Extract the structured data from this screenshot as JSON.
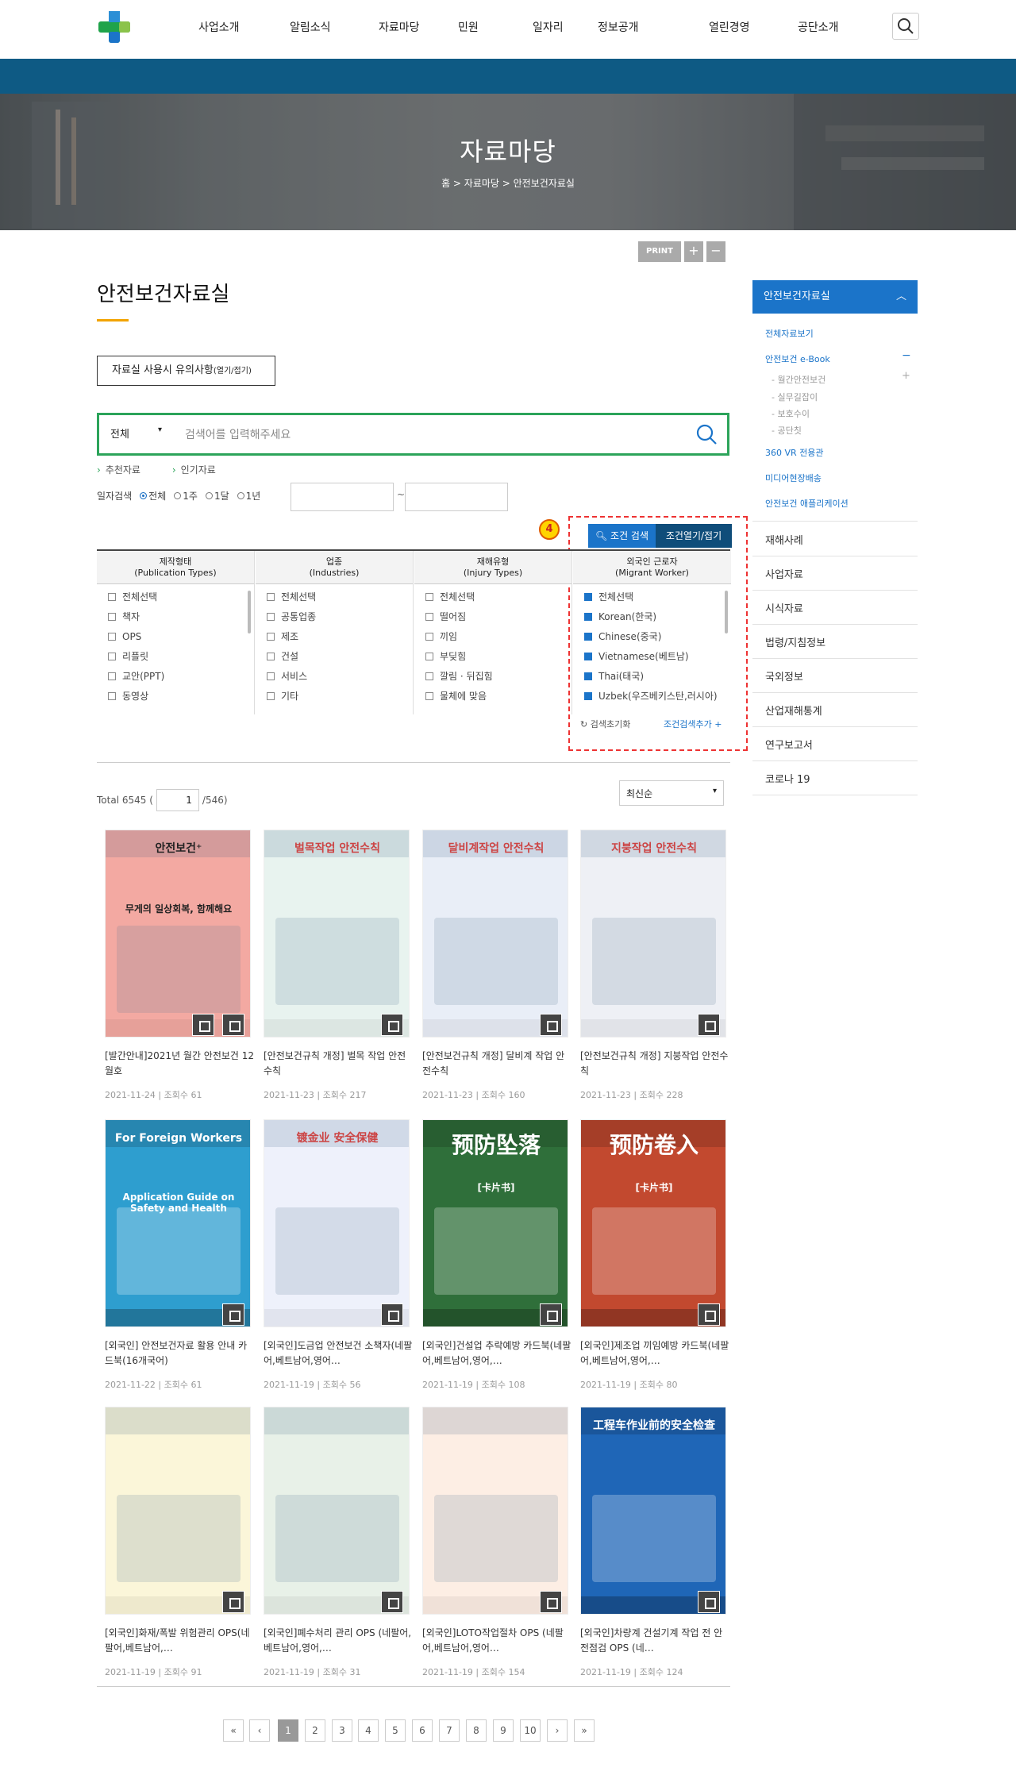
{
  "header": {
    "nav": [
      "사업소개",
      "알림소식",
      "자료마당",
      "민원",
      "일자리",
      "정보공개",
      "열린경영",
      "공단소개"
    ]
  },
  "hero": {
    "title": "자료마당",
    "breadcrumb": "홈  >  자료마당  >  안전보건자료실"
  },
  "tools": {
    "print": "PRINT",
    "zoom_in": "+",
    "zoom_out": "−"
  },
  "page": {
    "title": "안전보건자료실",
    "notice_button": "자료실 사용시 유의사항",
    "notice_toggle": "(열기/접기)"
  },
  "search": {
    "category": "전체",
    "placeholder": "검색어를 입력해주세요",
    "tags": [
      "추천자료",
      "인기자료"
    ],
    "date_label": "일자검색",
    "date_options": [
      "전체",
      "1주",
      "1달",
      "1년"
    ],
    "date_selected": "전체",
    "date_sep": "~"
  },
  "annotation": {
    "number": "4"
  },
  "filter": {
    "tab_search": "조건 검색",
    "tab_toggle": "조건열기/접기",
    "columns": [
      {
        "title": "제작형태",
        "subtitle": "(Publication Types)",
        "items": [
          "전체선택",
          "책자",
          "OPS",
          "리플릿",
          "교안(PPT)",
          "동영상"
        ],
        "checked": []
      },
      {
        "title": "업종",
        "subtitle": "(Industries)",
        "items": [
          "전체선택",
          "공통업종",
          "제조",
          "건설",
          "서비스",
          "기타"
        ],
        "checked": []
      },
      {
        "title": "재해유형",
        "subtitle": "(Injury Types)",
        "items": [
          "전체선택",
          "떨어짐",
          "끼임",
          "부딪힘",
          "깔림 · 뒤집힘",
          "물체에 맞음"
        ],
        "checked": []
      },
      {
        "title": "외국인 근로자",
        "subtitle": "(Migrant Worker)",
        "items": [
          "전체선택",
          "Korean(한국)",
          "Chinese(중국)",
          "Vietnamese(베트남)",
          "Thai(태국)",
          "Uzbek(우즈베키스탄,러시아)"
        ],
        "checked": [
          0,
          1,
          2,
          3,
          4,
          5
        ]
      }
    ],
    "reset": "검색초기화",
    "add": "조건검색추가 +"
  },
  "listing": {
    "total_label": "Total",
    "total": "6545",
    "current_page": "1",
    "total_pages": "/546)",
    "sort": "최신순"
  },
  "cards": [
    {
      "title": "[발간안내]2021년 월간 안전보건 12월호",
      "date": "2021-11-24",
      "views": "조회수 61",
      "cover_title": "안전보건⁺",
      "cover_text": "무게의 일상회복, 함께해요",
      "bg": "#f3a9a2"
    },
    {
      "title": "[안전보건규칙 개정] 벌목 작업 안전수칙",
      "date": "2021-11-23",
      "views": "조회수 217",
      "cover_title": "벌목작업 안전수칙",
      "bg": "#e8f3ef"
    },
    {
      "title": "[안전보건규칙 개정] 달비계 작업 안전수칙",
      "date": "2021-11-23",
      "views": "조회수 160",
      "cover_title": "달비계작업 안전수칙",
      "bg": "#e9eef7"
    },
    {
      "title": "[안전보건규칙 개정] 지붕작업 안전수칙",
      "date": "2021-11-23",
      "views": "조회수 228",
      "cover_title": "지붕작업 안전수칙",
      "bg": "#eef0f5"
    },
    {
      "title": "[외국인] 안전보건자료 활용 안내 카드북(16개국어)",
      "date": "2021-11-22",
      "views": "조회수 61",
      "cover_title": "For Foreign Workers",
      "cover_text": "Application Guide on Safety and Health",
      "bg": "#2e9ecf"
    },
    {
      "title": "[외국인]도금업 안전보건 소책자(네팔어,베트남어,영어…",
      "date": "2021-11-19",
      "views": "조회수 56",
      "cover_title": "镀金业 安全保健",
      "bg": "#eef1fb"
    },
    {
      "title": "[외국인]건설업 추락예방 카드북(네팔어,베트남어,영어,…",
      "date": "2021-11-19",
      "views": "조회수 108",
      "cover_title": "预防坠落",
      "cover_text": "[卡片书]",
      "bg": "#2f6f3a"
    },
    {
      "title": "[외국인]제조업 끼임예방 카드북(네팔어,베트남어,영어,…",
      "date": "2021-11-19",
      "views": "조회수 80",
      "cover_title": "预防卷入",
      "cover_text": "[卡片书]",
      "bg": "#c2492f"
    },
    {
      "title": "[외국인]화재/폭발 위험관리 OPS(네팔어,베트남어,…",
      "date": "2021-11-19",
      "views": "조회수 91",
      "cover_title": "",
      "bg": "#fbf6d9"
    },
    {
      "title": "[외국인]폐수처리 관리 OPS (네팔어,베트남어,영어,…",
      "date": "2021-11-19",
      "views": "조회수 31",
      "cover_title": "",
      "bg": "#e8f1e8"
    },
    {
      "title": "[외국인]LOTO작업절차 OPS (네팔어,베트남어,영어…",
      "date": "2021-11-19",
      "views": "조회수 154",
      "cover_title": "",
      "bg": "#fdeee4"
    },
    {
      "title": "[외국인]차량계 건설기계 작업 전 안전점검 OPS (네…",
      "date": "2021-11-19",
      "views": "조회수 124",
      "cover_title": "工程车作业前的安全检查",
      "bg": "#1f66b7"
    }
  ],
  "sidebar": {
    "header": "안전보건자료실",
    "links": [
      "전체자료보기",
      "안전보건 e-Book"
    ],
    "sub": [
      "월간안전보건",
      "실무길잡이",
      "보호수이",
      "공단칫"
    ],
    "links2": [
      "360 VR 전용관",
      "미디어현장배송",
      "안전보건 애플리케이션"
    ],
    "items": [
      "재해사례",
      "사업자료",
      "시식자료",
      "법령/지침정보",
      "국외정보",
      "산업재해통계",
      "연구보고서",
      "코로나 19"
    ]
  },
  "pagination": [
    "«",
    "‹",
    "1",
    "2",
    "3",
    "4",
    "5",
    "6",
    "7",
    "8",
    "9",
    "10",
    "›",
    "»"
  ],
  "colors": {
    "brand_blue": "#1b74c9",
    "navy_bar": "#0e5a84",
    "accent_green": "#2ca45a",
    "accent_orange": "#f2a300"
  }
}
